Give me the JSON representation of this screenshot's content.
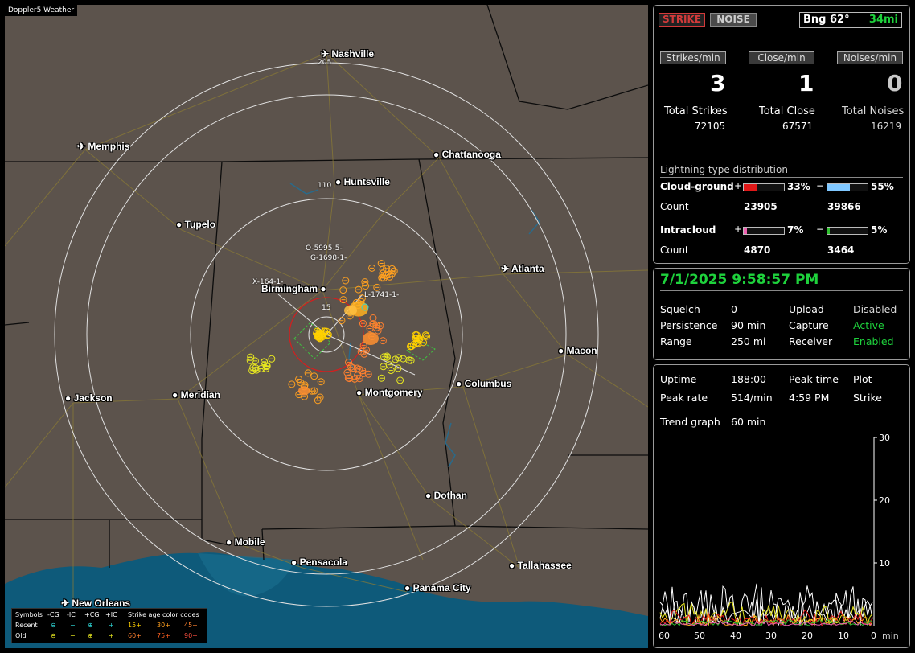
{
  "map": {
    "title": "Doppler5 Weather",
    "cities": [
      {
        "name": "Nashville",
        "icon": "airport-icon"
      },
      {
        "name": "Memphis",
        "icon": "airport-icon"
      },
      {
        "name": "Chattanooga",
        "icon": "city-dot-icon"
      },
      {
        "name": "Huntsville",
        "icon": "city-dot-icon"
      },
      {
        "name": "Tupelo",
        "icon": "city-dot-icon"
      },
      {
        "name": "Atlanta",
        "icon": "airport-icon"
      },
      {
        "name": "Birmingham",
        "icon": "city-dot-icon"
      },
      {
        "name": "Macon",
        "icon": "city-dot-icon"
      },
      {
        "name": "Columbus",
        "icon": "city-dot-icon"
      },
      {
        "name": "Jackson",
        "icon": "city-dot-icon"
      },
      {
        "name": "Meridian",
        "icon": "city-dot-icon"
      },
      {
        "name": "Montgomery",
        "icon": "city-dot-icon"
      },
      {
        "name": "Dothan",
        "icon": "city-dot-icon"
      },
      {
        "name": "Mobile",
        "icon": "city-dot-icon"
      },
      {
        "name": "Pensacola",
        "icon": "city-dot-icon"
      },
      {
        "name": "Tallahassee",
        "icon": "city-dot-icon"
      },
      {
        "name": "Panama City",
        "icon": "city-dot-icon"
      },
      {
        "name": "New Orleans",
        "icon": "airport-icon"
      }
    ],
    "ring_labels": [
      "205",
      "110",
      "15"
    ],
    "cluster_labels": [
      "O-5995-5-",
      "G-1698-1-",
      "X-164-1-",
      "L-1741-1-"
    ],
    "legend": {
      "symbols_label": "Symbols",
      "headers": [
        "-CG",
        "-IC",
        "+CG",
        "+IC"
      ],
      "age_label": "Strike age color codes",
      "recent_label": "Recent",
      "old_label": "Old",
      "recent_ages": [
        "15+",
        "30+",
        "45+"
      ],
      "old_ages": [
        "60+",
        "75+",
        "90+"
      ],
      "colors": {
        "recent": "#2fd6d6",
        "old": "#e8e820",
        "age15": "#ffd000",
        "age30": "#ffa020",
        "age45": "#ff8030",
        "age60": "#ff8030",
        "age75": "#ff6020",
        "age90": "#ff5040"
      }
    }
  },
  "status": {
    "strike_label": "STRIKE",
    "noise_label": "NOISE",
    "bearing": "Bng 62°",
    "distance": "34mi",
    "strikes_per_min_label": "Strikes/min",
    "close_per_min_label": "Close/min",
    "noises_per_min_label": "Noises/min",
    "strikes_per_min": "3",
    "close_per_min": "1",
    "noises_per_min": "0",
    "total_strikes_label": "Total Strikes",
    "total_close_label": "Total Close",
    "total_noises_label": "Total Noises",
    "total_strikes": "72105",
    "total_close": "67571",
    "total_noises": "16219"
  },
  "distribution": {
    "title": "Lightning type distribution",
    "cg_label": "Cloud-ground",
    "ic_label": "Intracloud",
    "count_label": "Count",
    "plus": "+",
    "minus": "−",
    "cg_pos_pct": "33%",
    "cg_neg_pct": "55%",
    "cg_pos_count": "23905",
    "cg_neg_count": "39866",
    "ic_pos_pct": "7%",
    "ic_neg_pct": "5%",
    "ic_pos_count": "4870",
    "ic_neg_count": "3464",
    "cg_pos_fraction": 0.33,
    "cg_neg_fraction": 0.55,
    "ic_pos_fraction": 0.07,
    "ic_neg_fraction": 0.05,
    "colors": {
      "cg_pos": "#e01818",
      "cg_neg": "#80c8ff",
      "ic_pos": "#f060b0",
      "ic_neg": "#30c030"
    }
  },
  "settings": {
    "datetime": "7/1/2025 9:58:57 PM",
    "squelch_label": "Squelch",
    "squelch": "0",
    "persistence_label": "Persistence",
    "persistence": "90 min",
    "range_label": "Range",
    "range": "250 mi",
    "upload_label": "Upload",
    "upload": "Disabled",
    "capture_label": "Capture",
    "capture": "Active",
    "receiver_label": "Receiver",
    "receiver": "Enabled"
  },
  "trend": {
    "uptime_label": "Uptime",
    "uptime": "188:00",
    "peak_time_label": "Peak time",
    "peak_time": "4:59 PM",
    "plot_label": "Plot",
    "plot": "Strike",
    "peak_rate_label": "Peak rate",
    "peak_rate": "514/min",
    "trend_label": "Trend graph",
    "trend_value": "60 min",
    "y_ticks": [
      "30",
      "20",
      "10"
    ],
    "x_ticks": [
      "60",
      "50",
      "40",
      "30",
      "20",
      "10",
      "0"
    ],
    "x_unit": "min"
  }
}
